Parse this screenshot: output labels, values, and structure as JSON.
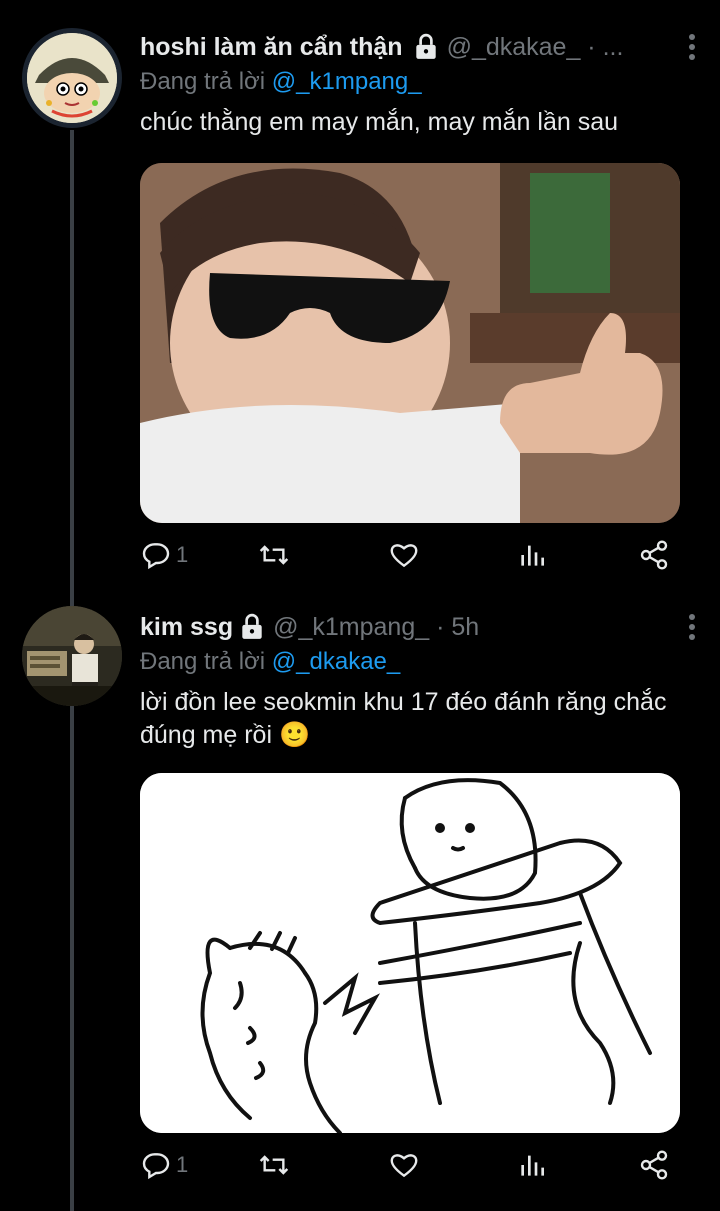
{
  "tweets": [
    {
      "display_name": "hoshi làm ăn cẩn thận",
      "handle": "@_dkakae_ · ...",
      "replying_prefix": "Đang trả lời",
      "replying_to": "@_k1mpang_",
      "text": "chúc thằng em may mắn, may mắn lần sau",
      "reply_count": "1",
      "avatar_icon": "shinchan-avatar",
      "media_icon": "baby-sunglasses-thumbs-up-image"
    },
    {
      "display_name": "kim ssg",
      "handle": "@_k1mpang_ · 5h",
      "replying_prefix": "Đang trả lời",
      "replying_to": "@_dkakae_",
      "text": "lời đồn lee seokmin khu 17 đéo đánh răng chắc đúng mẹ rồi 🙂",
      "reply_count": "1",
      "avatar_icon": "anime-scene-avatar",
      "media_icon": "cartoon-breath-sketch-image"
    }
  ],
  "colors": {
    "background": "#000000",
    "text_primary": "#e7e9ea",
    "text_secondary": "#71767b",
    "accent": "#1d9bf0",
    "thread_line": "#3a3f45"
  }
}
